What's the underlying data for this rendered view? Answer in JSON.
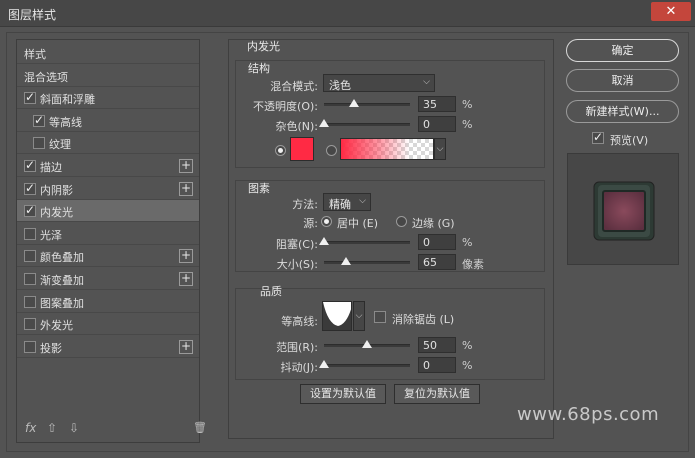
{
  "window": {
    "title": "图层样式",
    "close_glyph": "✕"
  },
  "style_list": {
    "items": [
      {
        "label": "样式",
        "checkbox": false,
        "checked": false,
        "plus": false,
        "indent": 0
      },
      {
        "label": "混合选项",
        "checkbox": false,
        "checked": false,
        "plus": false,
        "indent": 0
      },
      {
        "label": "斜面和浮雕",
        "checkbox": true,
        "checked": true,
        "plus": false,
        "indent": 0
      },
      {
        "label": "等高线",
        "checkbox": true,
        "checked": true,
        "plus": false,
        "indent": 1
      },
      {
        "label": "纹理",
        "checkbox": true,
        "checked": false,
        "plus": false,
        "indent": 1
      },
      {
        "label": "描边",
        "checkbox": true,
        "checked": true,
        "plus": true,
        "indent": 0
      },
      {
        "label": "内阴影",
        "checkbox": true,
        "checked": true,
        "plus": true,
        "indent": 0
      },
      {
        "label": "内发光",
        "checkbox": true,
        "checked": true,
        "plus": false,
        "indent": 0,
        "selected": true
      },
      {
        "label": "光泽",
        "checkbox": true,
        "checked": false,
        "plus": false,
        "indent": 0
      },
      {
        "label": "颜色叠加",
        "checkbox": true,
        "checked": false,
        "plus": true,
        "indent": 0
      },
      {
        "label": "渐变叠加",
        "checkbox": true,
        "checked": false,
        "plus": true,
        "indent": 0
      },
      {
        "label": "图案叠加",
        "checkbox": true,
        "checked": false,
        "plus": false,
        "indent": 0
      },
      {
        "label": "外发光",
        "checkbox": true,
        "checked": false,
        "plus": false,
        "indent": 0
      },
      {
        "label": "投影",
        "checkbox": true,
        "checked": false,
        "plus": true,
        "indent": 0
      }
    ],
    "plus_glyph": "+",
    "footer": {
      "fx": "fx",
      "up": "⇧",
      "down": "⇩",
      "trash": "🗑"
    }
  },
  "inner_glow": {
    "title": "内发光",
    "structure": {
      "title": "结构",
      "blend_mode_label": "混合模式:",
      "blend_mode_value": "浅色",
      "opacity_label": "不透明度(O):",
      "opacity_value": "35",
      "opacity_pct": 35,
      "noise_label": "杂色(N):",
      "noise_value": "0",
      "noise_pct": 0,
      "pct": "%",
      "glow_color": "#ff2a44",
      "arrow": "⌵"
    },
    "elements": {
      "title": "图素",
      "method_label": "方法:",
      "method_value": "精确",
      "source_label": "源:",
      "source_center": "居中 (E)",
      "source_edge": "边缘 (G)",
      "choke_label": "阻塞(C):",
      "choke_value": "0",
      "choke_pct": 0,
      "size_label": "大小(S):",
      "size_value": "65",
      "size_pct": 26,
      "size_unit": "像素"
    },
    "quality": {
      "title": "品质",
      "contour_label": "等高线:",
      "antialias_label": "消除锯齿 (L)",
      "range_label": "范围(R):",
      "range_value": "50",
      "range_pct": 50,
      "jitter_label": "抖动(J):",
      "jitter_value": "0",
      "jitter_pct": 0
    },
    "set_default": "设置为默认值",
    "reset_default": "复位为默认值"
  },
  "actions": {
    "ok": "确定",
    "cancel": "取消",
    "new_style": "新建样式(W)...",
    "preview_label": "预览(V)"
  },
  "watermark": "www.68ps.com"
}
